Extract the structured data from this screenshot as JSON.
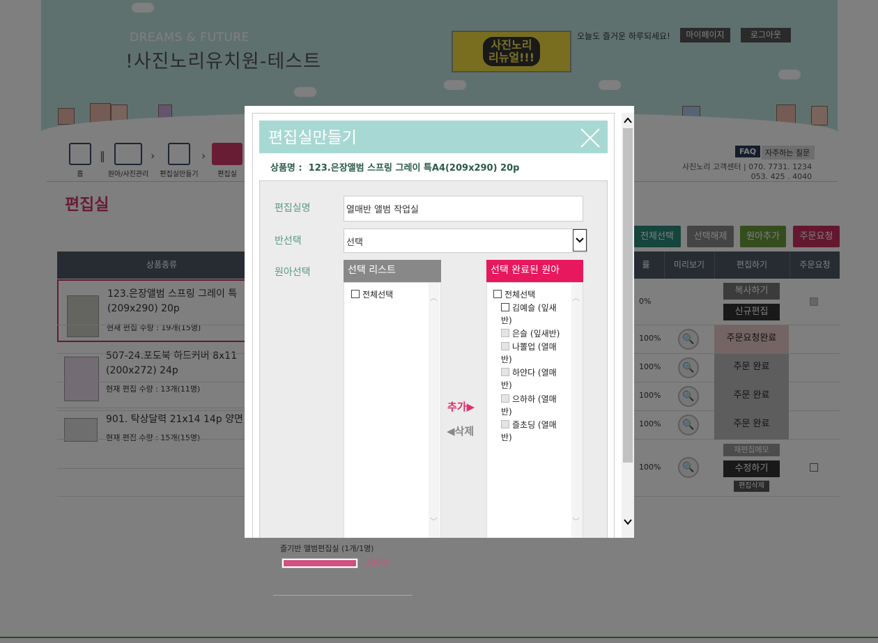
{
  "header": {
    "tagline": "DREAMS & FUTURE",
    "site_title": "!사진노리유치원-테스트",
    "banner": "사진노리\n리뉴얼!!!",
    "greeting": "오늘도 즐거운 하루되세요!",
    "mypage": "마이페이지",
    "logout": "로그아웃"
  },
  "nav": {
    "home": "홈",
    "children": "원아/사진관리",
    "make_room": "편집실만들기",
    "edit_room": "편집실",
    "faq_badge": "FAQ",
    "faq_text": "자주하는 질문",
    "center_line1": "사진노리 고객센터 |  070. 7731. 1234",
    "center_line2": "053. 425 . 4040"
  },
  "page_title": "편집실",
  "actions": {
    "select_all": "전체선택",
    "deselect": "선택해제",
    "add_child": "원아추가",
    "order_request": "주문요청"
  },
  "table": {
    "headers": {
      "product": "상품종류",
      "rate": "률",
      "preview": "미리보기",
      "edit": "편집하기",
      "order": "주문요청"
    },
    "products": [
      {
        "name": "123.은장앨범 스프링 그레이 특",
        "name2": "(209x290) 20p",
        "qty": "현재 편집 수량 : 19개(15명)"
      },
      {
        "name": "507-24.포토북 하드커버 8x11",
        "name2": "(200x272) 24p",
        "qty": "현재 편집 수량 : 13개(11명)"
      },
      {
        "name": "901. 탁상달력 21x14 14p 양면",
        "name2": "",
        "qty": "현재 편집 수량 : 15개(15명)"
      }
    ],
    "rows": [
      {
        "pct": "0%",
        "btn1": "복사하기",
        "btn2": "신규편집"
      },
      {
        "pct": "100%",
        "status": "주문요청완료"
      },
      {
        "pct": "100%",
        "status": "주문 완료"
      },
      {
        "pct": "100%",
        "status": "주문 완료"
      },
      {
        "pct": "100%",
        "status": "주문 완료"
      },
      {
        "pct": "100%",
        "memo": "재편집메모",
        "btn": "수정하기",
        "del": "편집삭제"
      }
    ]
  },
  "below": {
    "room_label": "즐기반 앨범편집실 (1개/1명)",
    "progress": 1.0,
    "progress_text": "100%"
  },
  "modal": {
    "title": "편집실만들기",
    "product_label": "상품명 :",
    "product_name": "123.은장앨범 스프링 그레이 특A4(209x290) 20p",
    "name_label": "편집실명",
    "name_value": "열매반 앨범 작업실",
    "class_label": "반선택",
    "class_value": "선택",
    "child_label": "원아선택",
    "left_list_title": "선택 리스트",
    "left_select_all": "전체선택",
    "right_list_title": "선택 완료된 원아",
    "right_select_all": "전체선택",
    "selected": [
      {
        "a": "김예슬 (잎새",
        "b": "반)"
      },
      {
        "a": "은슬 (잎새반)",
        "b": ""
      },
      {
        "a": "나뽈업 (열매",
        "b": "반)"
      },
      {
        "a": "하얀다 (열매",
        "b": "반)"
      },
      {
        "a": "으하하 (열매",
        "b": "반)"
      },
      {
        "a": "즐초딩 (열매",
        "b": "반)"
      }
    ],
    "add": "추가",
    "delete": "삭제"
  },
  "colors": {
    "accent_pink": "#e0306a",
    "teal_header": "#a8d8d4",
    "table_header": "#4f5965",
    "btn_teal": "#2a8a7a",
    "btn_gray": "#888888",
    "btn_green": "#6a9a3a",
    "btn_pink": "#c83060"
  }
}
